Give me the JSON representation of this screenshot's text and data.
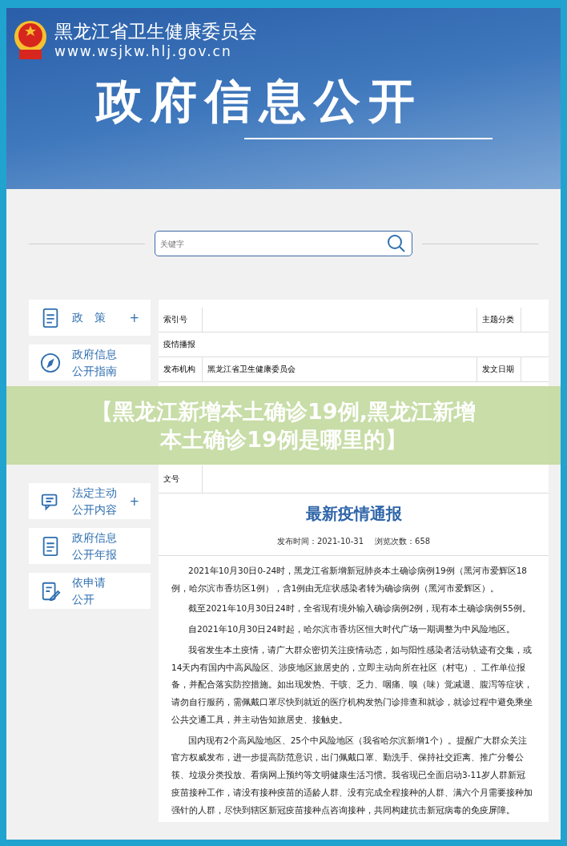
{
  "header": {
    "org_name": "黑龙江省卫生健康委员会",
    "url": "www.wsjkw.hlj.gov.cn",
    "title": "政府信息公开"
  },
  "search": {
    "placeholder": "关键字"
  },
  "sidebar": {
    "items_above": [
      {
        "kind": "document",
        "lines": [
          "政　策"
        ],
        "expandable": true
      },
      {
        "kind": "compass",
        "lines": [
          "政府信息",
          "公开指南"
        ],
        "expandable": false
      }
    ],
    "items_below": [
      {
        "kind": "chat",
        "lines": [
          "法定主动",
          "公开内容"
        ],
        "expandable": true
      },
      {
        "kind": "document",
        "lines": [
          "政府信息",
          "公开年报"
        ],
        "expandable": false
      },
      {
        "kind": "edit",
        "lines": [
          "依申请",
          "公开"
        ],
        "expandable": false
      }
    ]
  },
  "expand_symbol": "+",
  "meta_table": {
    "rows_above": [
      {
        "kind": "pair",
        "cells": [
          "索引号",
          "",
          "主题分类",
          ""
        ]
      },
      {
        "kind": "full",
        "colspan": 4,
        "cells": [
          "疫情播报"
        ]
      },
      {
        "kind": "pair",
        "cells": [
          "发布机构",
          "黑龙江省卫生健康委员会",
          "发文日期",
          ""
        ]
      }
    ],
    "rows_below": [
      {
        "kind": "single",
        "cells": [
          "文号",
          ""
        ]
      }
    ]
  },
  "article": {
    "title": "最新疫情通报",
    "publish_time": "发布时间：2021-10-31",
    "views": "浏览次数：658",
    "paragraphs": [
      "2021年10月30日0-24时，黑龙江省新增新冠肺炎本土确诊病例19例（黑河市爱辉区18例，哈尔滨市香坊区1例），含1例由无症状感染者转为确诊病例（黑河市爱辉区）。",
      "截至2021年10月30日24时，全省现有境外输入确诊病例2例，现有本土确诊病例55例。",
      "自2021年10月30日24时起，哈尔滨市香坊区恒大时代广场一期调整为中风险地区。",
      "我省发生本土疫情，请广大群众密切关注疫情动态，如与阳性感染者活动轨迹有交集，或14天内有国内中高风险区、涉疫地区旅居史的，立即主动向所在社区（村屯）、工作单位报备，并配合落实防控措施。如出现发热、干咳、乏力、咽痛、嗅（味）觉减退、腹泻等症状，请勿自行服药，需佩戴口罩尽快到就近的医疗机构发热门诊排查和就诊，就诊过程中避免乘坐公共交通工具，并主动告知旅居史、接触史。",
      "国内现有2个高风险地区、25个中风险地区（我省哈尔滨新增1个）。提醒广大群众关注官方权威发布，进一步提高防范意识，出门佩戴口罩、勤洗手、保持社交距离、推广分餐公筷、垃圾分类投放、看病网上预约等文明健康生活习惯。我省现已全面启动3-11岁人群新冠疫苗接种工作，请没有接种疫苗的适龄人群、没有完成全程接种的人群、满六个月需要接种加强针的人群，尽快到辖区新冠疫苗接种点咨询接种，共同构建抗击新冠病毒的免疫屏障。"
    ]
  },
  "banner": {
    "lines": [
      "【黑龙江新增本土确诊19例,黑龙江新增",
      "本土确诊19例是哪里的】"
    ]
  }
}
